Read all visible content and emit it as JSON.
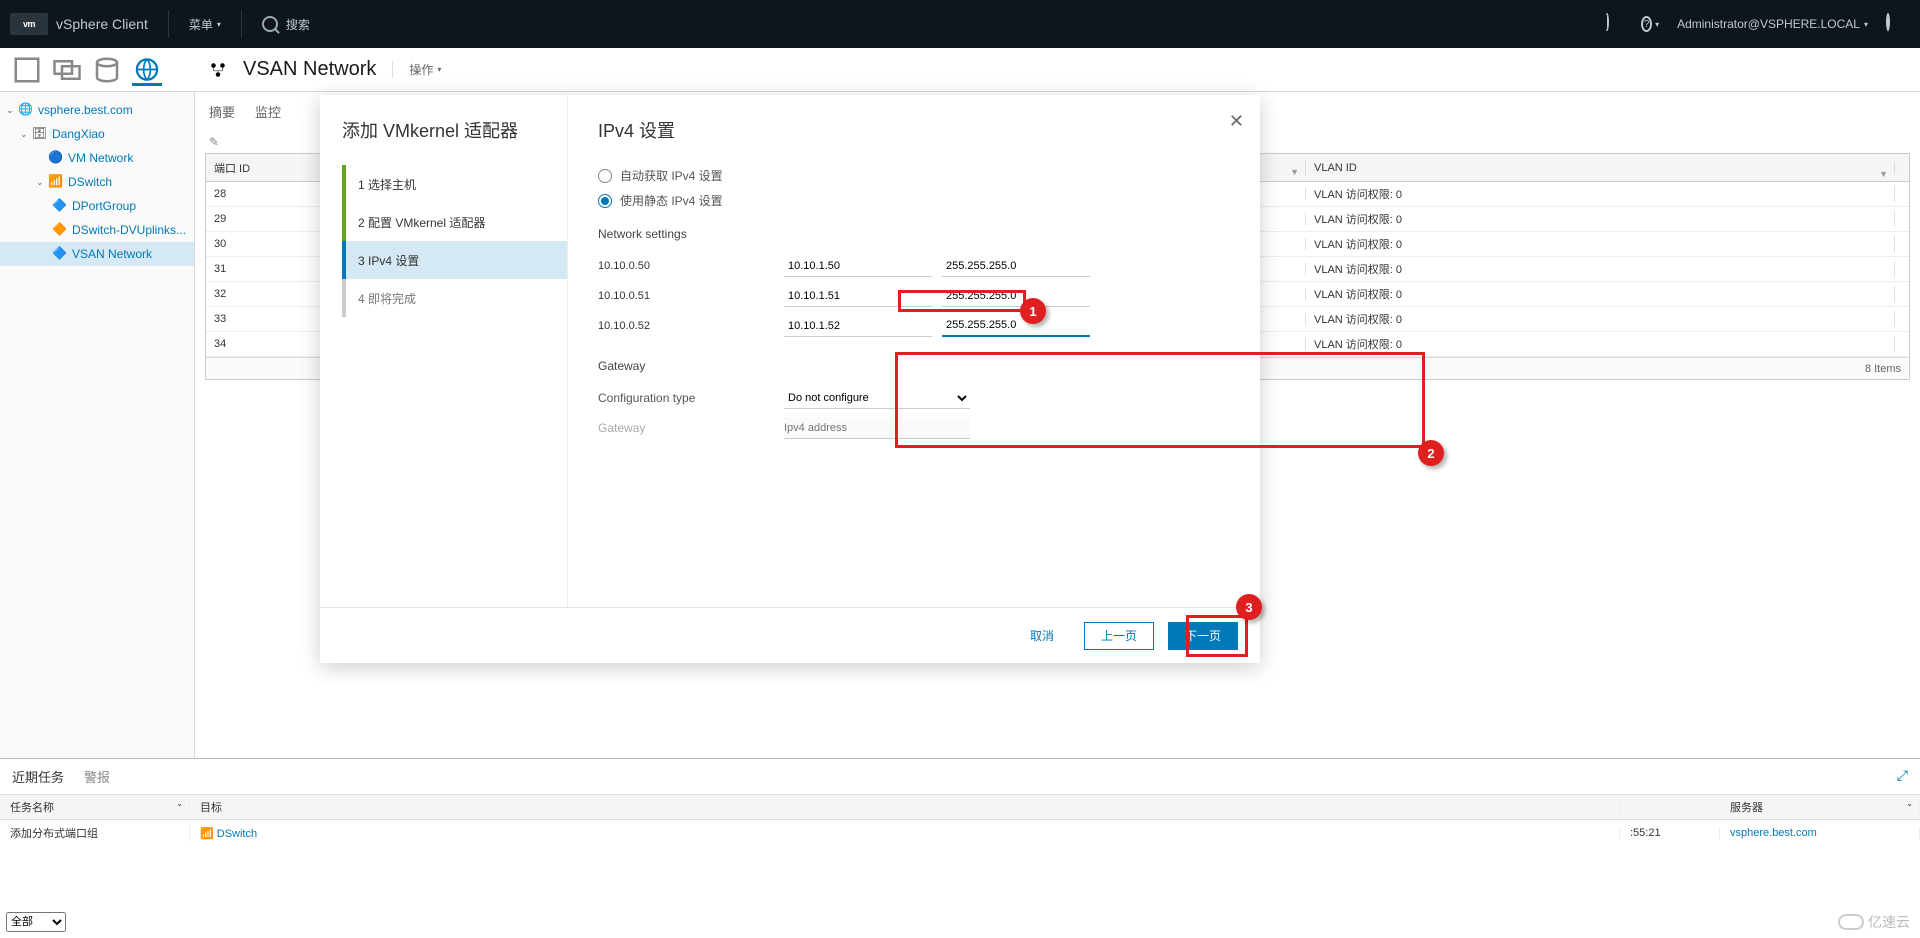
{
  "topbar": {
    "logo": "vm",
    "title": "vSphere Client",
    "menu": "菜单",
    "search_placeholder": "搜索",
    "user": "Administrator@VSPHERE.LOCAL"
  },
  "header": {
    "title": "VSAN Network",
    "actions": "操作"
  },
  "tree": {
    "root": "vsphere.best.com",
    "datacenter": "DangXiao",
    "vmnetwork": "VM Network",
    "dswitch": "DSwitch",
    "dportgroup": "DPortGroup",
    "uplinks": "DSwitch-DVUplinks...",
    "vsan": "VSAN Network"
  },
  "tabs": {
    "summary": "摘要",
    "monitor": "监控"
  },
  "grid": {
    "col_port": "端口 ID",
    "col_vlan": "VLAN ID",
    "vlan_value": "VLAN 访问权限: 0",
    "rows": [
      "28",
      "29",
      "30",
      "31",
      "32",
      "33",
      "34"
    ],
    "footer": "8 Items"
  },
  "bottom": {
    "tab_recent": "近期任务",
    "tab_alarm": "警报",
    "col_task": "任务名称",
    "col_target": "目标",
    "col_server": "服务器",
    "task": "添加分布式端口组",
    "target": "DSwitch",
    "time": ":55:21",
    "server": "vsphere.best.com",
    "filter_all": "全部"
  },
  "modal": {
    "wiz_title": "添加 VMkernel 适配器",
    "steps": {
      "s1": "1  选择主机",
      "s2": "2  配置 VMkernel 适配器",
      "s3": "3  IPv4 设置",
      "s4": "4  即将完成"
    },
    "right_title": "IPv4 设置",
    "radio_auto": "自动获取 IPv4 设置",
    "radio_static": "使用静态 IPv4 设置",
    "sec_network": "Network settings",
    "rows": [
      {
        "host": "10.10.0.50",
        "ip": "10.10.1.50",
        "mask": "255.255.255.0"
      },
      {
        "host": "10.10.0.51",
        "ip": "10.10.1.51",
        "mask": "255.255.255.0"
      },
      {
        "host": "10.10.0.52",
        "ip": "10.10.1.52",
        "mask": "255.255.255.0"
      }
    ],
    "sec_gateway": "Gateway",
    "cfg_type_label": "Configuration type",
    "cfg_type_value": "Do not configure",
    "gateway_label": "Gateway",
    "gateway_placeholder": "Ipv4 address",
    "btn_cancel": "取消",
    "btn_back": "上一页",
    "btn_next": "下一页"
  },
  "annotations": {
    "b1": "1",
    "b2": "2",
    "b3": "3"
  },
  "watermark": "亿速云"
}
